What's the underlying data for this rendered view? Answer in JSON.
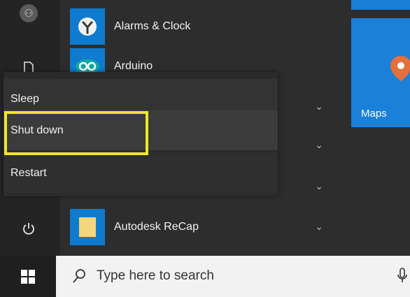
{
  "apps": [
    {
      "label": "Alarms & Clock",
      "icon": "alarm-clock-icon"
    },
    {
      "label": "Arduino",
      "icon": "arduino-icon"
    },
    {
      "label": "Autodesk ReCap",
      "icon": "folder-icon"
    }
  ],
  "tiles": {
    "maps_label": "Maps"
  },
  "power_menu": {
    "sleep": "Sleep",
    "shut_down": "Shut down",
    "restart": "Restart"
  },
  "taskbar": {
    "search_placeholder": "Type here to search"
  },
  "colors": {
    "accent_blue": "#1a80d8",
    "highlight_yellow": "#f1e529",
    "menu_background": "#2d2d2d"
  }
}
